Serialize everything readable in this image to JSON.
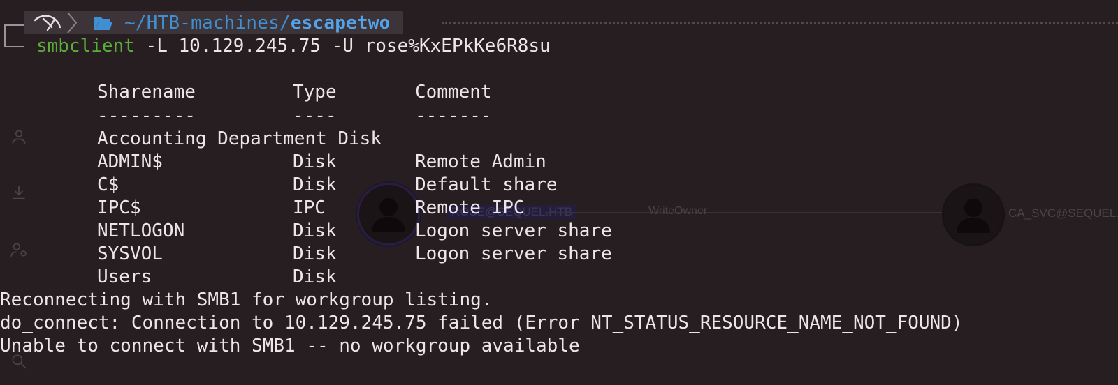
{
  "prompt": {
    "path_prefix": "~/HTB-machines/",
    "path_current": "escapetwo",
    "command_name": "smbclient",
    "command_args": " -L 10.129.245.75 -U rose%KxEPkKe6R8su"
  },
  "share_table": {
    "headers": [
      "Sharename",
      "Type",
      "Comment"
    ],
    "separators": [
      "---------",
      "----",
      "-------"
    ],
    "rows": [
      {
        "name": "Accounting Department Disk",
        "type": "",
        "comment": ""
      },
      {
        "name": "ADMIN$",
        "type": "Disk",
        "comment": "Remote Admin"
      },
      {
        "name": "C$",
        "type": "Disk",
        "comment": "Default share"
      },
      {
        "name": "IPC$",
        "type": "IPC",
        "comment": "Remote IPC"
      },
      {
        "name": "NETLOGON",
        "type": "Disk",
        "comment": "Logon server share"
      },
      {
        "name": "SYSVOL",
        "type": "Disk",
        "comment": "Logon server share"
      },
      {
        "name": "Users",
        "type": "Disk",
        "comment": ""
      }
    ]
  },
  "output_lines": [
    "Reconnecting with SMB1 for workgroup listing.",
    "do_connect: Connection to 10.129.245.75 failed (Error NT_STATUS_RESOURCE_NAME_NOT_FOUND)",
    "Unable to connect with SMB1 -- no workgroup available"
  ],
  "background": {
    "edge_label": "WriteOwner",
    "node_left_label": "ROSE@SEQUEL.HTB",
    "node_right_label": "CA_SVC@SEQUEL."
  },
  "icons": [
    "kali-dragon-icon",
    "folder-open-icon",
    "user-icon",
    "download-icon",
    "user-settings-icon",
    "search-icon"
  ],
  "colors": {
    "background": "#261e21",
    "prompt_segment": "#3c3439",
    "path_blue": "#3f8fd2",
    "command_green": "#5eaa3b",
    "text": "#ebe6e7"
  }
}
